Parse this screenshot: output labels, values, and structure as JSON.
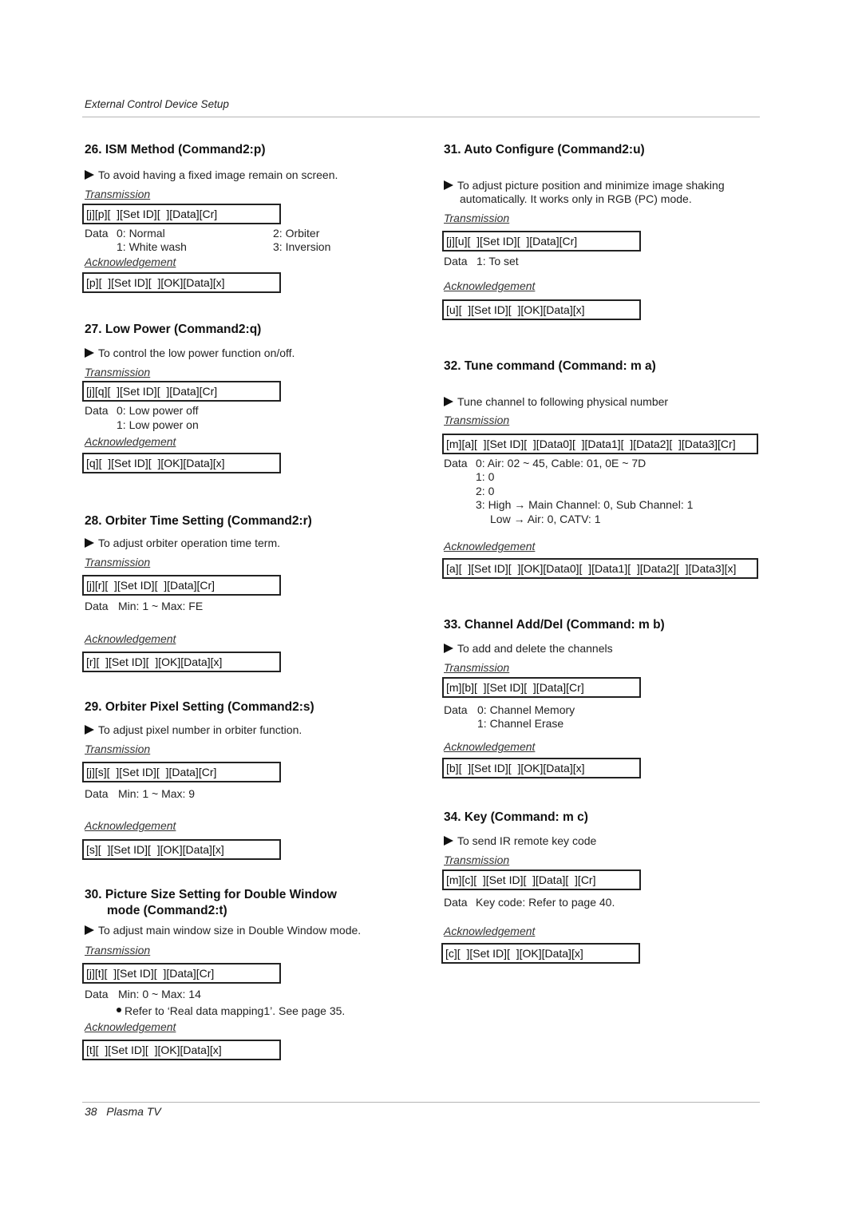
{
  "header": {
    "running_title": "External Control Device Setup"
  },
  "labels": {
    "transmission": "Transmission",
    "acknowledgement": "Acknowledgement",
    "data": "Data"
  },
  "sections": {
    "s26": {
      "title": "26. ISM Method (Command2:p)",
      "description": "To avoid having a fixed image remain on screen.",
      "transmission": "[j][p][  ][Set ID][  ][Data][Cr]",
      "data": [
        "0: Normal",
        "1: White wash",
        "2: Orbiter",
        "3: Inversion"
      ],
      "acknowledgement": "[p][  ][Set ID][  ][OK][Data][x]"
    },
    "s27": {
      "title": "27. Low Power (Command2:q)",
      "description": "To control the low power function on/off.",
      "transmission": "[j][q][  ][Set ID][  ][Data][Cr]",
      "data": [
        "0: Low power off",
        "1: Low power on"
      ],
      "acknowledgement": "[q][  ][Set ID][  ][OK][Data][x]"
    },
    "s28": {
      "title": "28. Orbiter Time Setting (Command2:r)",
      "description": "To adjust orbiter operation time term.",
      "transmission": "[j][r][  ][Set ID][  ][Data][Cr]",
      "data": [
        "Min: 1 ~ Max: FE"
      ],
      "acknowledgement": "[r][  ][Set ID][  ][OK][Data][x]"
    },
    "s29": {
      "title": "29. Orbiter Pixel Setting (Command2:s)",
      "description": "To adjust pixel number in orbiter function.",
      "transmission": "[j][s][  ][Set ID][  ][Data][Cr]",
      "data": [
        "Min: 1 ~ Max: 9"
      ],
      "acknowledgement": "[s][  ][Set ID][  ][OK][Data][x]"
    },
    "s30": {
      "title_line1": "30. Picture Size Setting for Double Window",
      "title_line2": "mode (Command2:t)",
      "description": "To adjust main window size in Double Window mode.",
      "transmission": "[j][t][  ][Set ID][  ][Data][Cr]",
      "data": [
        "Min: 0 ~ Max: 14"
      ],
      "note": "Refer to ‘Real data mapping1’. See page 35.",
      "acknowledgement": "[t][  ][Set ID][  ][OK][Data][x]"
    },
    "s31": {
      "title": "31. Auto Configure (Command2:u)",
      "description_line1": "To adjust picture position and minimize image shaking",
      "description_line2": "automatically. It works only in RGB (PC) mode.",
      "transmission": "[j][u][  ][Set ID][  ][Data][Cr]",
      "data": [
        "1: To set"
      ],
      "acknowledgement": "[u][  ][Set ID][  ][OK][Data][x]"
    },
    "s32": {
      "title": "32. Tune command (Command: m a)",
      "description": "Tune channel to following physical number",
      "transmission": "[m][a][  ][Set ID][  ][Data0][  ][Data1][  ][Data2][  ][Data3][Cr]",
      "data": [
        "0: Air: 02 ~ 45, Cable: 01, 0E ~ 7D",
        "1: 0",
        "2: 0",
        "3: High → Main Channel: 0, Sub Channel: 1",
        "Low → Air: 0, CATV: 1"
      ],
      "acknowledgement": "[a][  ][Set ID][  ][OK][Data0][  ][Data1][  ][Data2][  ][Data3][x]"
    },
    "s33": {
      "title": "33. Channel Add/Del (Command: m b)",
      "description": "To add and delete the channels",
      "transmission": "[m][b][  ][Set ID][  ][Data][Cr]",
      "data": [
        "0: Channel Memory",
        "1: Channel Erase"
      ],
      "acknowledgement": "[b][  ][Set ID][  ][OK][Data][x]"
    },
    "s34": {
      "title": "34. Key (Command: m c)",
      "description": "To send IR remote key code",
      "transmission": "[m][c][  ][Set ID][  ][Data][  ][Cr]",
      "data": [
        "Key code: Refer to page 40."
      ],
      "acknowledgement": "[c][  ][Set ID][  ][OK][Data][x]"
    }
  },
  "footer": {
    "page_number": "38",
    "product": "Plasma TV"
  }
}
